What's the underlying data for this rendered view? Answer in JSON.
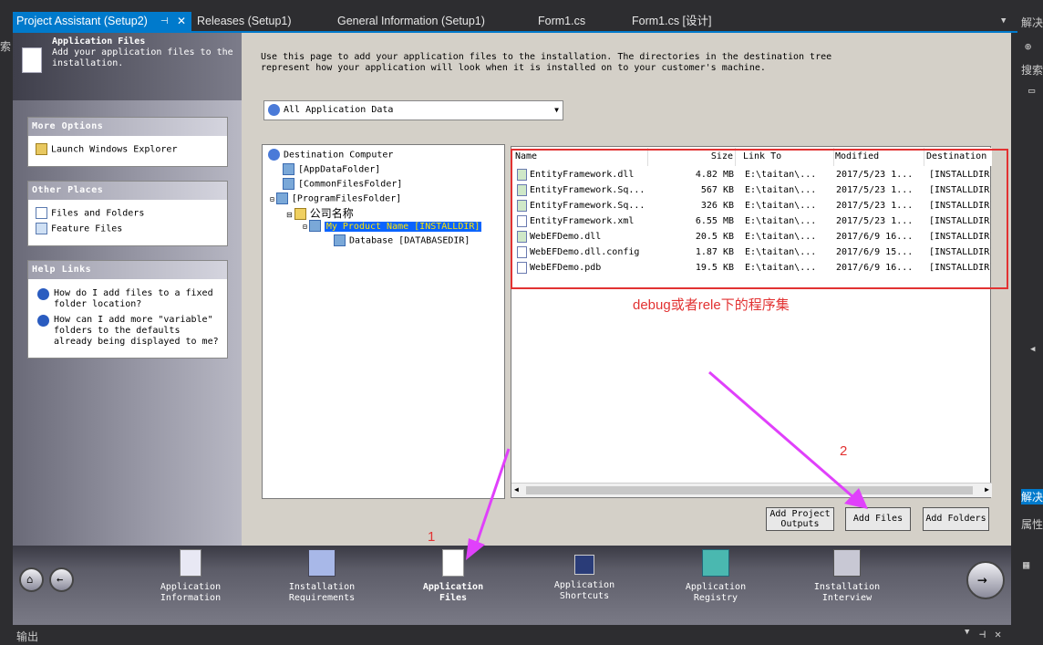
{
  "tabs": [
    {
      "label": "Project Assistant (Setup2)",
      "active": true
    },
    {
      "label": "Releases (Setup1)"
    },
    {
      "label": "General Information (Setup1)"
    },
    {
      "label": "Form1.cs"
    },
    {
      "label": "Form1.cs [设计]"
    }
  ],
  "right_panel": {
    "label1": "解决",
    "label2": "搜索",
    "label3": "解决",
    "label4": "属性"
  },
  "left_edge": {
    "label1": "索"
  },
  "header": {
    "title": "Application Files",
    "subtitle": "Add your application files to the installation."
  },
  "more_options": {
    "title": "More Options",
    "items": [
      "Launch Windows Explorer"
    ]
  },
  "other_places": {
    "title": "Other Places",
    "items": [
      "Files and Folders",
      "Feature Files"
    ]
  },
  "help_links": {
    "title": "Help Links",
    "items": [
      "How do I add files to a fixed folder location?",
      "How can I add more \"variable\" folders to the defaults already being displayed to me?"
    ]
  },
  "description": "Use this page to add your application files to the installation. The directories in the destination tree represent how your application will look when it is installed on to your customer's machine.",
  "combo": {
    "value": "All Application Data"
  },
  "tree": [
    {
      "label": "Destination Computer",
      "level": 0
    },
    {
      "label": "[AppDataFolder]",
      "level": 1
    },
    {
      "label": "[CommonFilesFolder]",
      "level": 1
    },
    {
      "label": "[ProgramFilesFolder]",
      "level": 1
    },
    {
      "label": "公司名称",
      "level": 2
    },
    {
      "label": "My Product Name [INSTALLDIR]",
      "level": 3,
      "selected": true
    },
    {
      "label": "Database [DATABASEDIR]",
      "level": 4
    }
  ],
  "list": {
    "columns": [
      "Name",
      "Size",
      "Link To",
      "Modified",
      "Destination"
    ],
    "rows": [
      [
        "EntityFramework.dll",
        "4.82 MB",
        "E:\\taitan\\...",
        "2017/5/23 1...",
        "[INSTALLDIR]"
      ],
      [
        "EntityFramework.Sq...",
        "567 KB",
        "E:\\taitan\\...",
        "2017/5/23 1...",
        "[INSTALLDIR]"
      ],
      [
        "EntityFramework.Sq...",
        "326 KB",
        "E:\\taitan\\...",
        "2017/5/23 1...",
        "[INSTALLDIR]"
      ],
      [
        "EntityFramework.xml",
        "6.55 MB",
        "E:\\taitan\\...",
        "2017/5/23 1...",
        "[INSTALLDIR]"
      ],
      [
        "WebEFDemo.dll",
        "20.5 KB",
        "E:\\taitan\\...",
        "2017/6/9 16...",
        "[INSTALLDIR]"
      ],
      [
        "WebEFDemo.dll.config",
        "1.87 KB",
        "E:\\taitan\\...",
        "2017/6/9 15...",
        "[INSTALLDIR]"
      ],
      [
        "WebEFDemo.pdb",
        "19.5 KB",
        "E:\\taitan\\...",
        "2017/6/9 16...",
        "[INSTALLDIR]"
      ]
    ]
  },
  "annotation": {
    "text": "debug或者rele下的程序集",
    "label1": "1",
    "label2": "2",
    "color": "#e23232",
    "arrow_color": "#e040fb"
  },
  "buttons": {
    "add_project_outputs": "Add Project Outputs",
    "add_files": "Add Files",
    "add_folders": "Add Folders"
  },
  "nav": [
    {
      "label": "Application Information"
    },
    {
      "label": "Installation Requirements"
    },
    {
      "label": "Application Files",
      "active": true
    },
    {
      "label": "Application Shortcuts"
    },
    {
      "label": "Application Registry"
    },
    {
      "label": "Installation Interview"
    }
  ],
  "output": {
    "title": "输出"
  }
}
